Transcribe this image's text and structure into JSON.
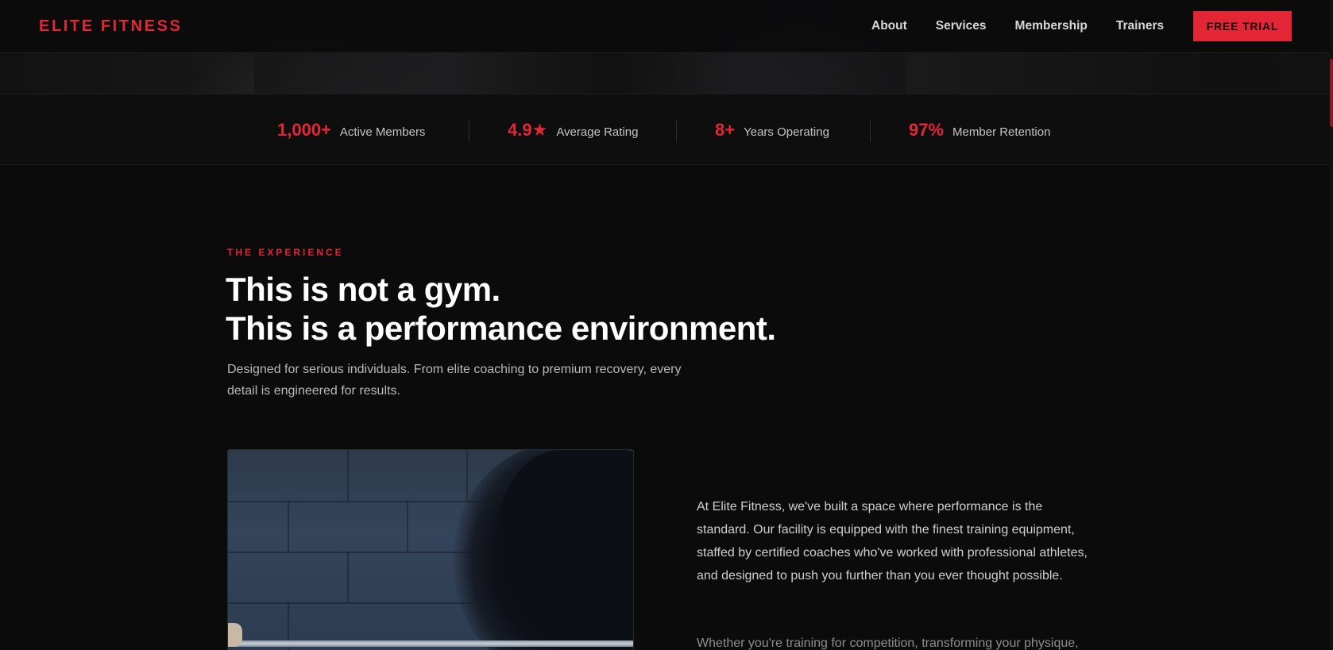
{
  "brand": {
    "name": "ELITE FITNESS",
    "accent_color": "#e32636",
    "background_color": "#0b0b0c"
  },
  "nav": {
    "links": [
      {
        "label": "About"
      },
      {
        "label": "Services"
      },
      {
        "label": "Membership"
      },
      {
        "label": "Trainers"
      }
    ],
    "cta_label": "FREE TRIAL"
  },
  "stats": [
    {
      "value": "1,000+",
      "label": "Active Members"
    },
    {
      "value": "4.9★",
      "label": "Average Rating"
    },
    {
      "value": "8+",
      "label": "Years Operating"
    },
    {
      "value": "97%",
      "label": "Member Retention"
    }
  ],
  "experience": {
    "eyebrow": "THE EXPERIENCE",
    "headline_line1": "This is not a gym.",
    "headline_line2": "This is a performance environment.",
    "subcopy": "Designed for serious individuals. From elite coaching to premium recovery, every detail is engineered for results.",
    "body_paragraph_1": "At Elite Fitness, we've built a space where performance is the standard. Our facility is equipped with the finest training equipment, staffed by certified coaches who've worked with professional athletes, and designed to push you further than you ever thought possible.",
    "body_paragraph_2": "Whether you're training for competition, transforming your physique,"
  }
}
